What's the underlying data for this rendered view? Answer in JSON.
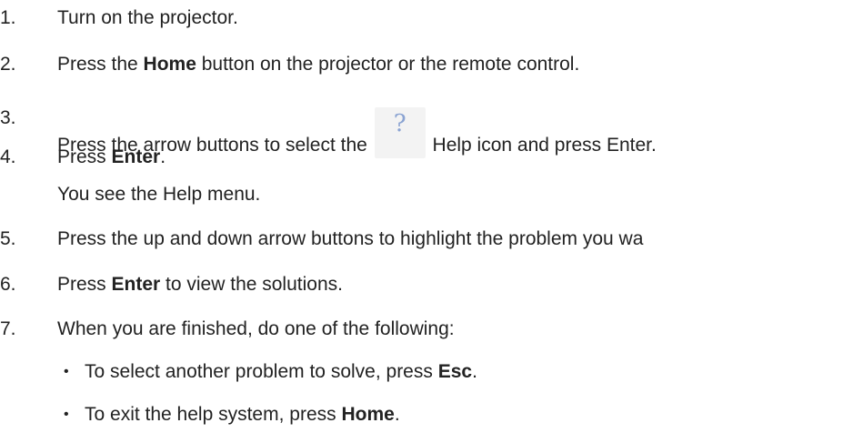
{
  "steps": [
    {
      "num": "1.",
      "text": "Turn on the projector."
    },
    {
      "num": "2.",
      "pre": "Press the ",
      "bold": "Home",
      "post": " button on the projector or the remote control."
    },
    {
      "num": "3.",
      "pre": "Press the arrow buttons to select the",
      "icon": "help-question-icon",
      "icon_glyph": "?",
      "post": "Help icon and press Enter."
    },
    {
      "num": "4.",
      "pre": "Press ",
      "bold": "Enter",
      "post": ".",
      "sub": "You see the Help menu."
    },
    {
      "num": "5.",
      "text": "Press the up and down arrow buttons to highlight the problem you wa"
    },
    {
      "num": "6.",
      "pre": "Press ",
      "bold": "Enter",
      "post": " to view the solutions."
    },
    {
      "num": "7.",
      "text": "When you are finished, do one of the following:"
    }
  ],
  "bullets": [
    {
      "glyph": "•",
      "pre": "To select another problem to solve, press ",
      "bold": "Esc",
      "post": "."
    },
    {
      "glyph": "•",
      "pre": "To exit the help system, press ",
      "bold": "Home",
      "post": "."
    }
  ]
}
